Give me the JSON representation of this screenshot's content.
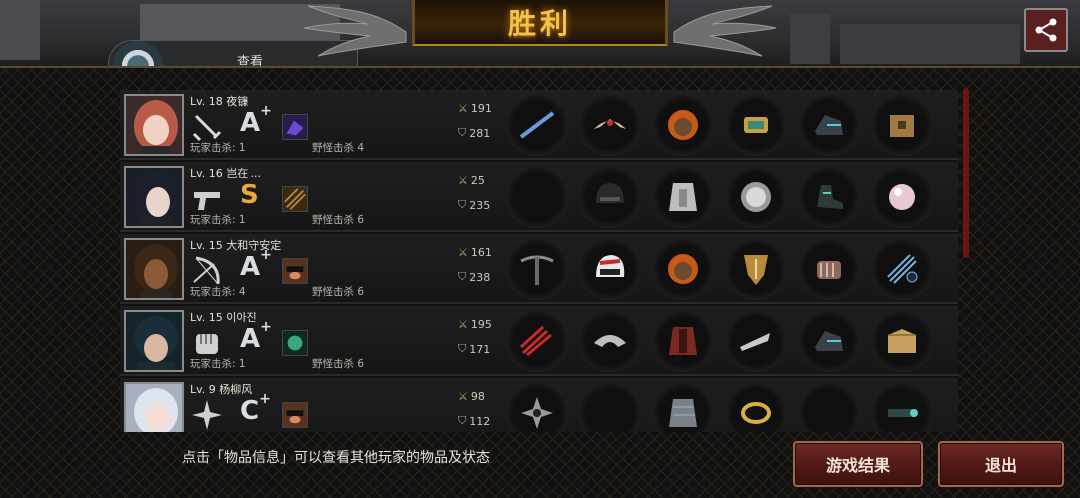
{
  "header": {
    "title": "胜利",
    "back_tab_label": "查看"
  },
  "share_icon": "share-icon",
  "players": [
    {
      "level": "Lv. 18",
      "name": "夜镰",
      "grade": "A",
      "grade_sup": "+",
      "kills_label": "玩家击杀: 1",
      "monster_label": "野怪击杀 4",
      "atk": "191",
      "def": "281",
      "weapon_icon": "sword-icon"
    },
    {
      "level": "Lv. 16",
      "name": "岂在 ...",
      "grade": "S",
      "grade_sup": "",
      "kills_label": "玩家击杀: 1",
      "monster_label": "野怪击杀 6",
      "atk": "25",
      "def": "235",
      "weapon_icon": "pistol-icon"
    },
    {
      "level": "Lv. 15",
      "name": "大和守安定",
      "grade": "A",
      "grade_sup": "+",
      "kills_label": "玩家击杀: 4",
      "monster_label": "野怪击杀 6",
      "atk": "161",
      "def": "238",
      "weapon_icon": "bow-icon"
    },
    {
      "level": "Lv. 15",
      "name": "이아진",
      "grade": "A",
      "grade_sup": "+",
      "kills_label": "玩家击杀: 1",
      "monster_label": "野怪击杀 6",
      "atk": "195",
      "def": "171",
      "weapon_icon": "fist-icon"
    },
    {
      "level": "Lv. 9",
      "name": "杨柳风",
      "grade": "C",
      "grade_sup": "+",
      "kills_label": "",
      "monster_label": "",
      "atk": "98",
      "def": "112",
      "weapon_icon": "shuriken-icon"
    }
  ],
  "hint": "点击「物品信息」可以查看其他玩家的物品及状态",
  "buttons": {
    "results": "游戏结果",
    "exit": "退出"
  },
  "colors": {
    "accent_gold": "#f3c24a",
    "button_red": "#5a1c17"
  }
}
